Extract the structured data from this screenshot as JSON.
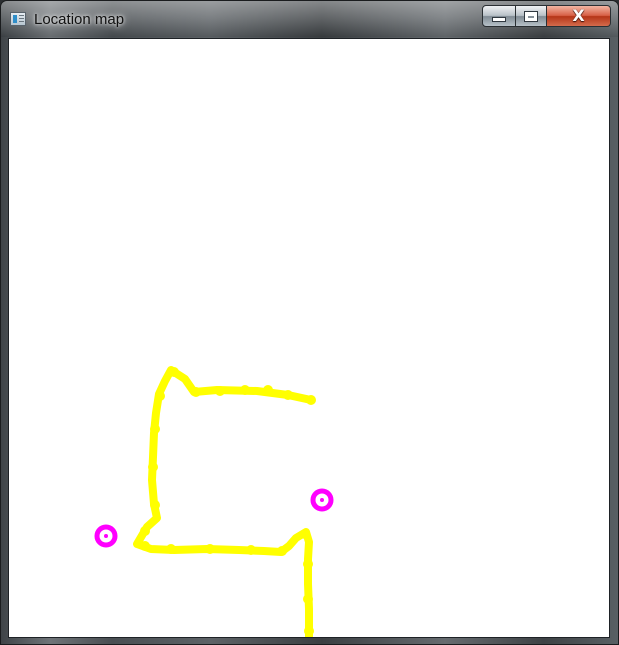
{
  "window": {
    "title": "Location map",
    "controls": {
      "minimize_icon": "minimize-icon",
      "maximize_icon": "maximize-icon",
      "close_icon": "close-icon",
      "close_glyph": "X"
    }
  },
  "map": {
    "colors": {
      "background": "#ffffff",
      "path": "#ffff00",
      "marker": "#ff00ff"
    },
    "path_count": 1,
    "marker_count": 2
  }
}
